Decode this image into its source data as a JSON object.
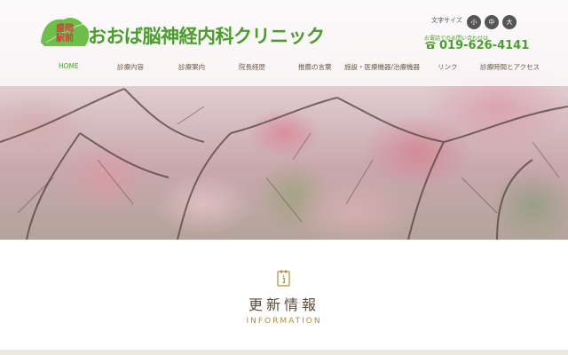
{
  "logo": {
    "badge_line1": "盛岡",
    "badge_line2": "駅前",
    "leaf_color": "#6cc04a",
    "badge_color": "#d63a3a"
  },
  "site_title": "おおば脳神経内科クリニック",
  "font_size": {
    "label": "文字サイズ",
    "small": "小",
    "medium": "中",
    "large": "大"
  },
  "contact": {
    "note": "お電話でのお問い合わせは",
    "phone": "019-626-4141",
    "icon": "phone-icon"
  },
  "nav": {
    "items": [
      {
        "label": "HOME",
        "active": true
      },
      {
        "label": "診療内容"
      },
      {
        "label": "診療案内"
      },
      {
        "label": "院長経歴"
      },
      {
        "label": "推薦の言葉"
      },
      {
        "label": "施設・医療機器/治療機器"
      },
      {
        "label": "リンク"
      },
      {
        "label": "診療時間とアクセス"
      }
    ]
  },
  "info": {
    "icon": "info-icon",
    "title": "更新情報",
    "subtitle": "INFORMATION"
  },
  "colors": {
    "accent_green": "#4a9e2c",
    "gold": "#b08c3c",
    "text_brown": "#5a4a3a"
  }
}
